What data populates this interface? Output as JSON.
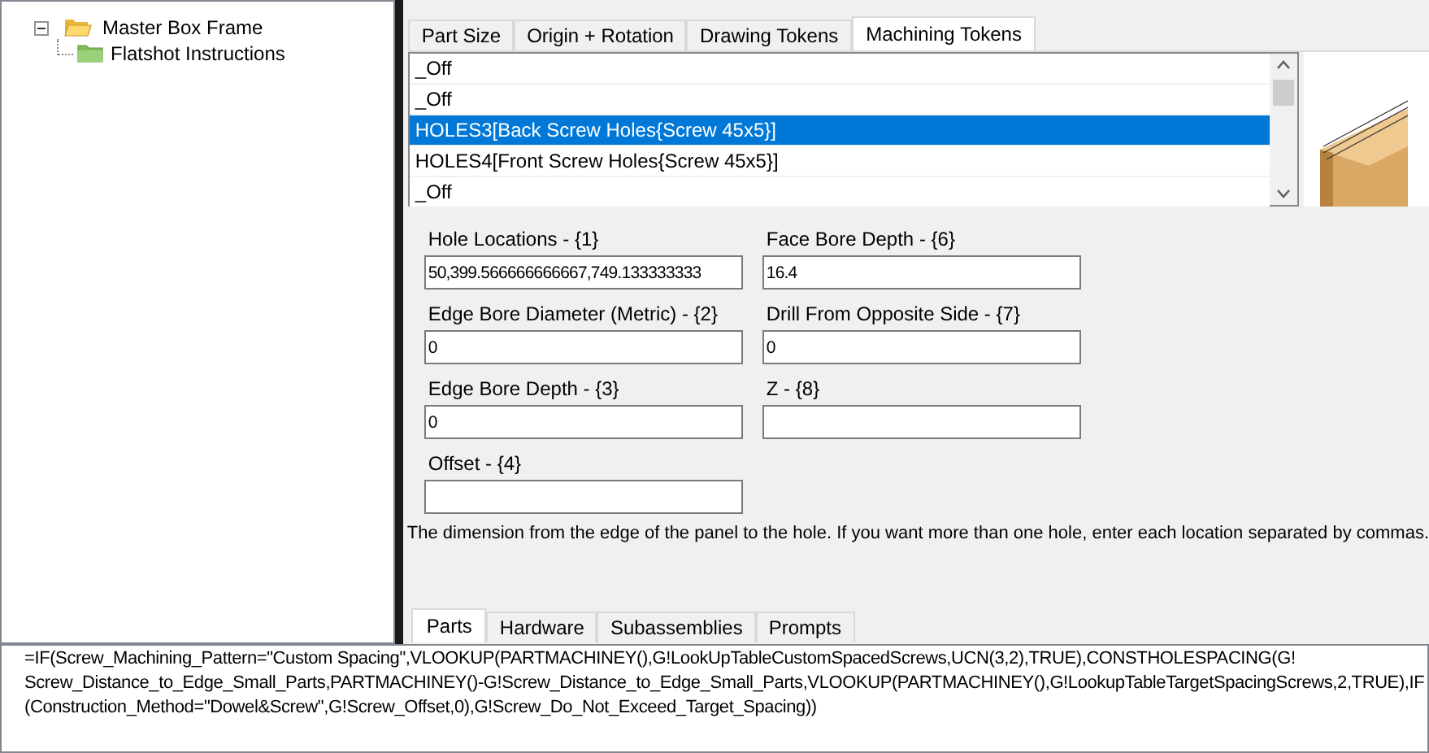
{
  "tree": [
    {
      "label": "Master Box Frame",
      "expanded": true,
      "children": [
        {
          "label": "Flatshot Instructions"
        }
      ]
    }
  ],
  "tabs": [
    {
      "label": "Part  Size",
      "selected": false
    },
    {
      "label": "Origin + Rotation",
      "selected": false
    },
    {
      "label": "Drawing Tokens",
      "selected": false
    },
    {
      "label": "Machining Tokens",
      "selected": true
    }
  ],
  "token_list": [
    {
      "label": "_Off",
      "selected": false
    },
    {
      "label": "_Off",
      "selected": false
    },
    {
      "label": "HOLES3[Back Screw Holes{Screw 45x5}]",
      "selected": true
    },
    {
      "label": "HOLES4[Front Screw Holes{Screw 45x5}]",
      "selected": false
    },
    {
      "label": "_Off",
      "selected": false
    }
  ],
  "fields_left": [
    {
      "label": "Hole Locations - {1}",
      "value": "50,399.566666666667,749.133333333"
    },
    {
      "label": "Edge Bore Diameter (Metric) - {2}",
      "value": "0"
    },
    {
      "label": "Edge Bore Depth - {3}",
      "value": "0"
    },
    {
      "label": "Offset - {4}"
    }
  ],
  "fields_right": [
    {
      "label": "Face Bore Depth - {6}",
      "value": "16.4"
    },
    {
      "label": "Drill From Opposite Side - {7}",
      "value": "0"
    },
    {
      "label": "Z - {8}"
    }
  ],
  "description": "The dimension from the edge of the panel to the hole. If you want more than one hole, enter each location separated by commas.",
  "bottom_tabs": [
    {
      "label": "Parts",
      "selected": true
    },
    {
      "label": "Hardware",
      "selected": false
    },
    {
      "label": "Subassemblies",
      "selected": false
    },
    {
      "label": "Prompts",
      "selected": false
    }
  ],
  "formula_lines": [
    "=IF(Screw_Machining_Pattern=\"Custom Spacing\",VLOOKUP(PARTMACHINEY(),G!LookUpTableCustomSpacedScrews,UCN(3,2),TRUE),CONSTHOLESPACING(G!",
    "Screw_Distance_to_Edge_Small_Parts,PARTMACHINEY()-G!Screw_Distance_to_Edge_Small_Parts,VLOOKUP(PARTMACHINEY(),G!LookupTableTargetSpacingScrews,2,TRUE),IF",
    "(Construction_Method=\"Dowel&Screw\",G!Screw_Offset,0),G!Screw_Do_Not_Exceed_Target_Spacing))"
  ]
}
